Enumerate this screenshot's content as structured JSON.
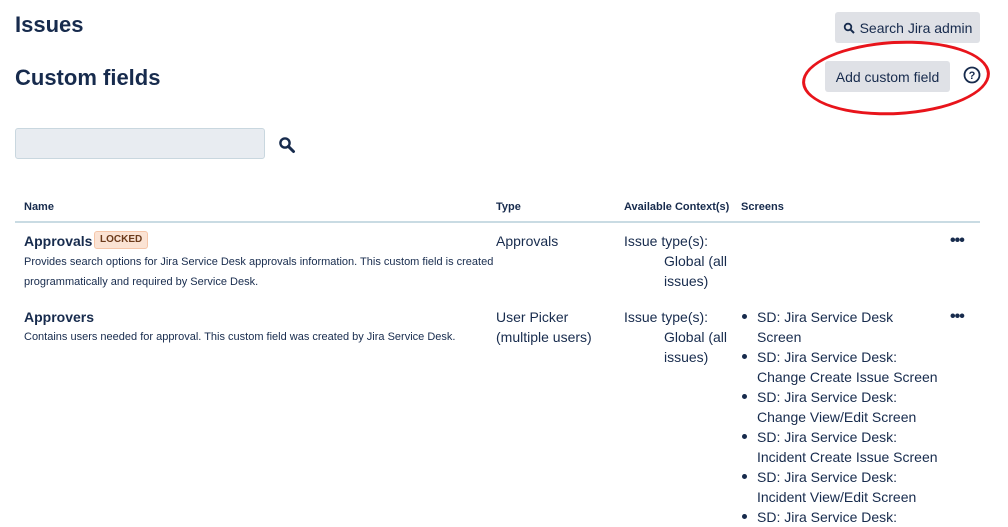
{
  "header": {
    "section_title": "Issues",
    "page_title": "Custom fields",
    "search_admin_label": "Search Jira admin",
    "add_custom_field_label": "Add custom field"
  },
  "search": {
    "value": "",
    "placeholder": ""
  },
  "table": {
    "columns": [
      "Name",
      "Type",
      "Available Context(s)",
      "Screens"
    ],
    "rows": [
      {
        "name": "Approvals",
        "badge": "LOCKED",
        "description": "Provides search options for Jira Service Desk approvals information. This custom field is created programmatically and required by Service Desk.",
        "type": "Approvals",
        "context_label": "Issue type(s):",
        "context_value": "Global (all issues)",
        "screens": []
      },
      {
        "name": "Approvers",
        "description": "Contains users needed for approval. This custom field was created by Jira Service Desk.",
        "type": "User Picker (multiple users)",
        "context_label": "Issue type(s):",
        "context_value": "Global (all issues)",
        "screens": [
          "SD: Jira Service Desk Screen",
          "SD: Jira Service Desk: Change Create Issue Screen",
          "SD: Jira Service Desk: Change View/Edit Screen",
          "SD: Jira Service Desk: Incident Create Issue Screen",
          "SD: Jira Service Desk: Incident View/Edit Screen",
          "SD: Jira Service Desk:"
        ]
      }
    ]
  },
  "icons": {
    "search": "search-icon",
    "help": "help-icon",
    "more": "more-actions-icon"
  },
  "colors": {
    "annotation_oval": "#e8141b",
    "button_bg": "#dfe1e6",
    "text": "#172b4d"
  }
}
